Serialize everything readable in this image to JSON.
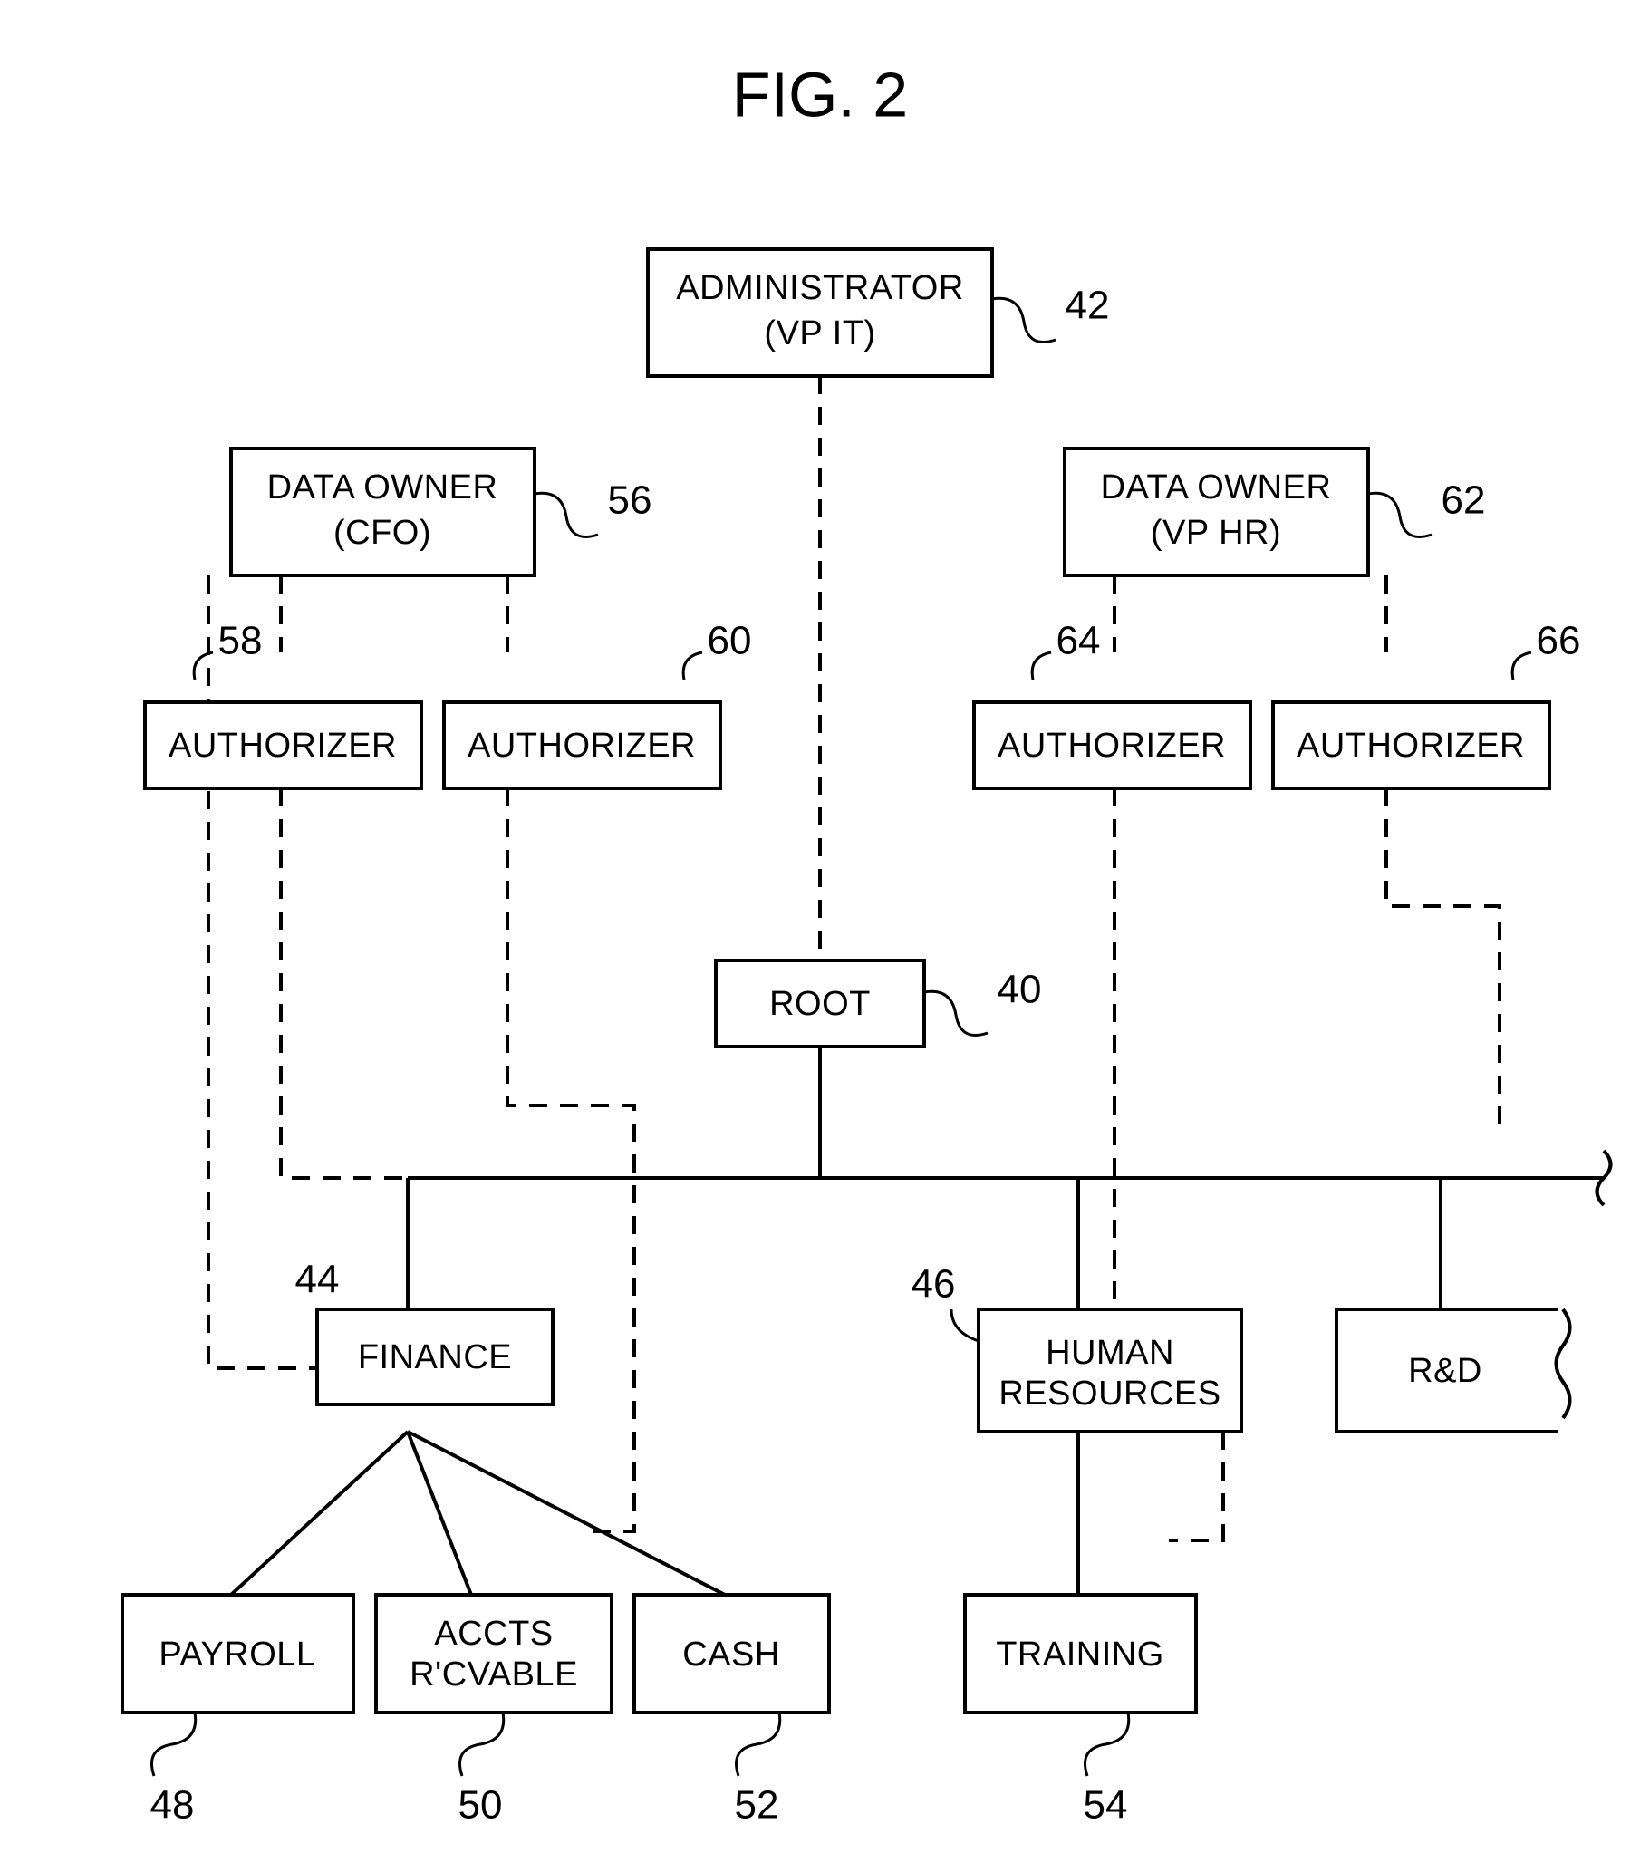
{
  "title": "FIG. 2",
  "nodes": {
    "admin": {
      "l1": "ADMINISTRATOR",
      "l2": "(VP IT)",
      "ref": "42"
    },
    "ownerCFO": {
      "l1": "DATA OWNER",
      "l2": "(CFO)",
      "ref": "56"
    },
    "ownerHR": {
      "l1": "DATA OWNER",
      "l2": "(VP HR)",
      "ref": "62"
    },
    "auth58": {
      "l1": "AUTHORIZER",
      "ref": "58"
    },
    "auth60": {
      "l1": "AUTHORIZER",
      "ref": "60"
    },
    "auth64": {
      "l1": "AUTHORIZER",
      "ref": "64"
    },
    "auth66": {
      "l1": "AUTHORIZER",
      "ref": "66"
    },
    "root": {
      "l1": "ROOT",
      "ref": "40"
    },
    "finance": {
      "l1": "FINANCE",
      "ref": "44"
    },
    "hr": {
      "l1": "HUMAN",
      "l2": "RESOURCES",
      "ref": "46"
    },
    "rnd": {
      "l1": "R&D"
    },
    "payroll": {
      "l1": "PAYROLL",
      "ref": "48"
    },
    "accts": {
      "l1": "ACCTS",
      "l2": "R'CVABLE",
      "ref": "50"
    },
    "cash": {
      "l1": "CASH",
      "ref": "52"
    },
    "training": {
      "l1": "TRAINING",
      "ref": "54"
    }
  }
}
